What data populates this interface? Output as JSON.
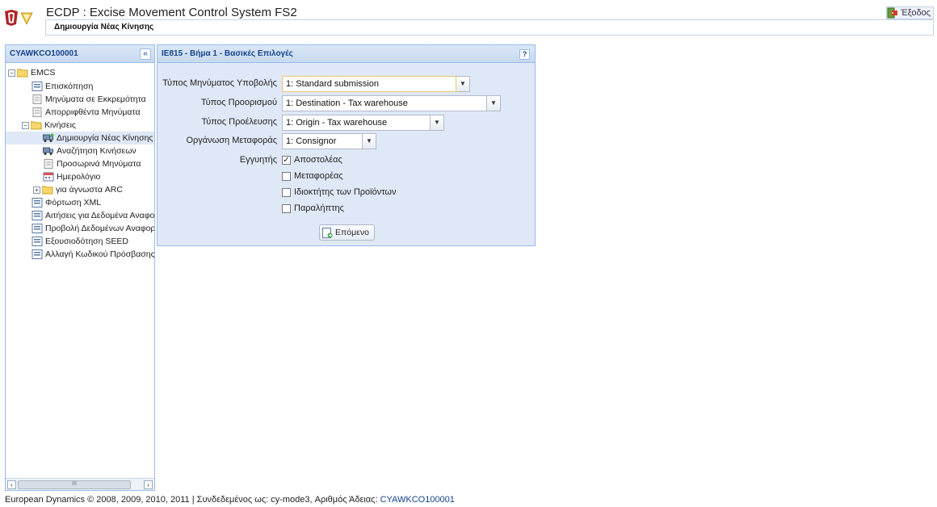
{
  "header": {
    "app_title": "ECDP : Excise Movement Control System FS2",
    "subtitle": "Δημιουργία Νέας Κίνησης",
    "logout_label": "Έξοδος"
  },
  "left_panel": {
    "title": "CYAWKCO100001",
    "tree": [
      {
        "label": "EMCS",
        "icon": "folder-icon",
        "toggle": "−"
      },
      {
        "label": "Επισκόπηση",
        "icon": "form-icon"
      },
      {
        "label": "Μηνύματα σε Εκκρεμότητα",
        "icon": "document-icon"
      },
      {
        "label": "Απορριφθέντα Μηνύματα",
        "icon": "document-icon"
      },
      {
        "label": "Κινήσεις",
        "icon": "folder-icon",
        "toggle": "−"
      },
      {
        "label": "Δημιουργία Νέας Κίνησης",
        "icon": "truck-add-icon"
      },
      {
        "label": "Αναζήτηση Κινήσεων",
        "icon": "truck-search-icon"
      },
      {
        "label": "Προσωρινά Μηνύματα",
        "icon": "document-icon"
      },
      {
        "label": "Ημερολόγιο",
        "icon": "calendar-icon"
      },
      {
        "label": "για άγνωστα ARC",
        "icon": "folder-icon",
        "toggle": "+"
      },
      {
        "label": "Φόρτωση XML",
        "icon": "form-icon"
      },
      {
        "label": "Αιτήσεις για Δεδομένα Αναφοράς",
        "icon": "form-icon"
      },
      {
        "label": "Προβολή Δεδομένων Αναφοράς",
        "icon": "form-icon"
      },
      {
        "label": "Εξουσιοδότηση SEED",
        "icon": "form-icon"
      },
      {
        "label": "Αλλαγή Κωδικού Πρόσβασης",
        "icon": "form-icon"
      }
    ],
    "scroll_thumb_label": "III"
  },
  "main_panel": {
    "title": "IE815 - Βήμα 1 - Βασικές Επιλογές",
    "help_label": "?",
    "fields": {
      "submission_type": {
        "label": "Τύπος Μηνύματος Υποβολής",
        "value": "1: Standard submission"
      },
      "destination_type": {
        "label": "Τύπος Προορισμού",
        "value": "1: Destination - Tax warehouse"
      },
      "origin_type": {
        "label": "Τύπος Προέλευσης",
        "value": "1: Origin - Tax warehouse"
      },
      "transport_arrangement": {
        "label": "Οργάνωση Μεταφοράς",
        "value": "1: Consignor"
      }
    },
    "guarantor": {
      "label": "Εγγυητής",
      "options": [
        {
          "label": "Αποστολέας",
          "checked": true
        },
        {
          "label": "Μεταφορέας",
          "checked": false
        },
        {
          "label": "Ιδιοκτήτης των Προϊόντων",
          "checked": false
        },
        {
          "label": "Παραλήπτης",
          "checked": false
        }
      ]
    },
    "next_button_label": "Επόμενο"
  },
  "footer": {
    "text": "European Dynamics © 2008, 2009, 2010, 2011 | Συνδεδεμένος ως: cy-mode3, Αριθμός Άδειας: ",
    "license": "CYAWKCO100001"
  },
  "colors": {
    "panel_header_text": "#15428b",
    "panel_border": "#99bbe8",
    "panel_body": "#dfe8f6"
  }
}
